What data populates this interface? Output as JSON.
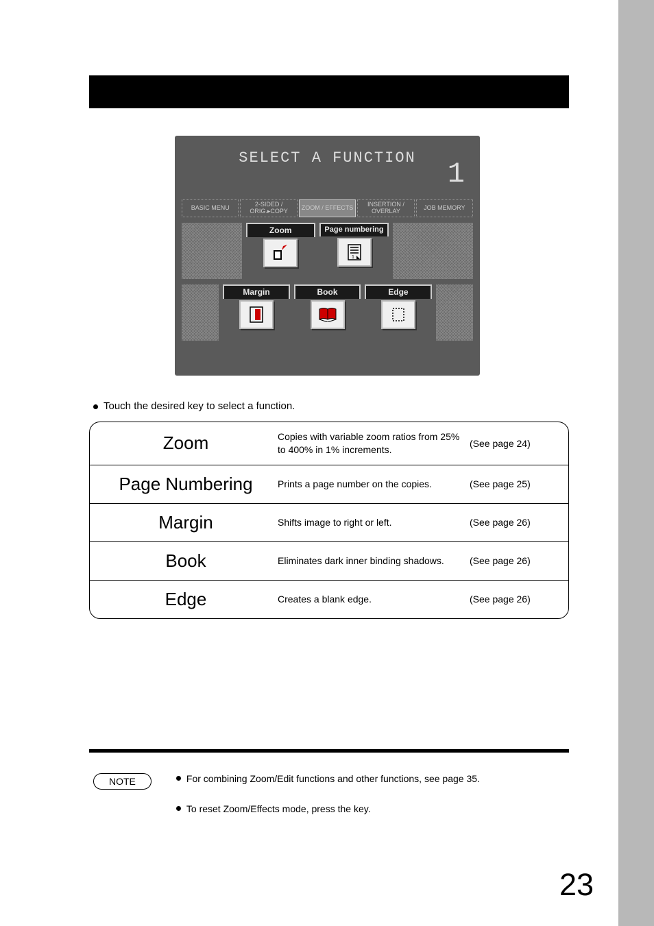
{
  "lcd": {
    "title": "SELECT A FUNCTION",
    "counter": "1",
    "tabs": [
      "BASIC MENU",
      "2-SIDED / ORIG.▸COPY",
      "ZOOM / EFFECTS",
      "INSERTION / OVERLAY",
      "JOB MEMORY"
    ],
    "buttons_row1": [
      {
        "label": "Zoom"
      },
      {
        "label": "Page numbering"
      }
    ],
    "buttons_row2": [
      {
        "label": "Margin"
      },
      {
        "label": "Book"
      },
      {
        "label": "Edge"
      }
    ]
  },
  "instruction": "Touch the desired key to select a function.",
  "functions": [
    {
      "name": "Zoom",
      "desc": "Copies with variable zoom ratios from 25% to 400% in 1% increments.",
      "page": "(See page 24)"
    },
    {
      "name": "Page Numbering",
      "desc": "Prints a page number on the copies.",
      "page": "(See page 25)"
    },
    {
      "name": "Margin",
      "desc": "Shifts image to right or left.",
      "page": "(See page 26)"
    },
    {
      "name": "Book",
      "desc": "Eliminates dark inner binding shadows.",
      "page": "(See page 26)"
    },
    {
      "name": "Edge",
      "desc": "Creates a blank edge.",
      "page": "(See page 26)"
    }
  ],
  "note": {
    "label": "NOTE",
    "lines": [
      "For combining Zoom/Edit functions and other functions, see page 35.",
      "To reset Zoom/Effects mode, press the            key."
    ]
  },
  "page_number": "23"
}
